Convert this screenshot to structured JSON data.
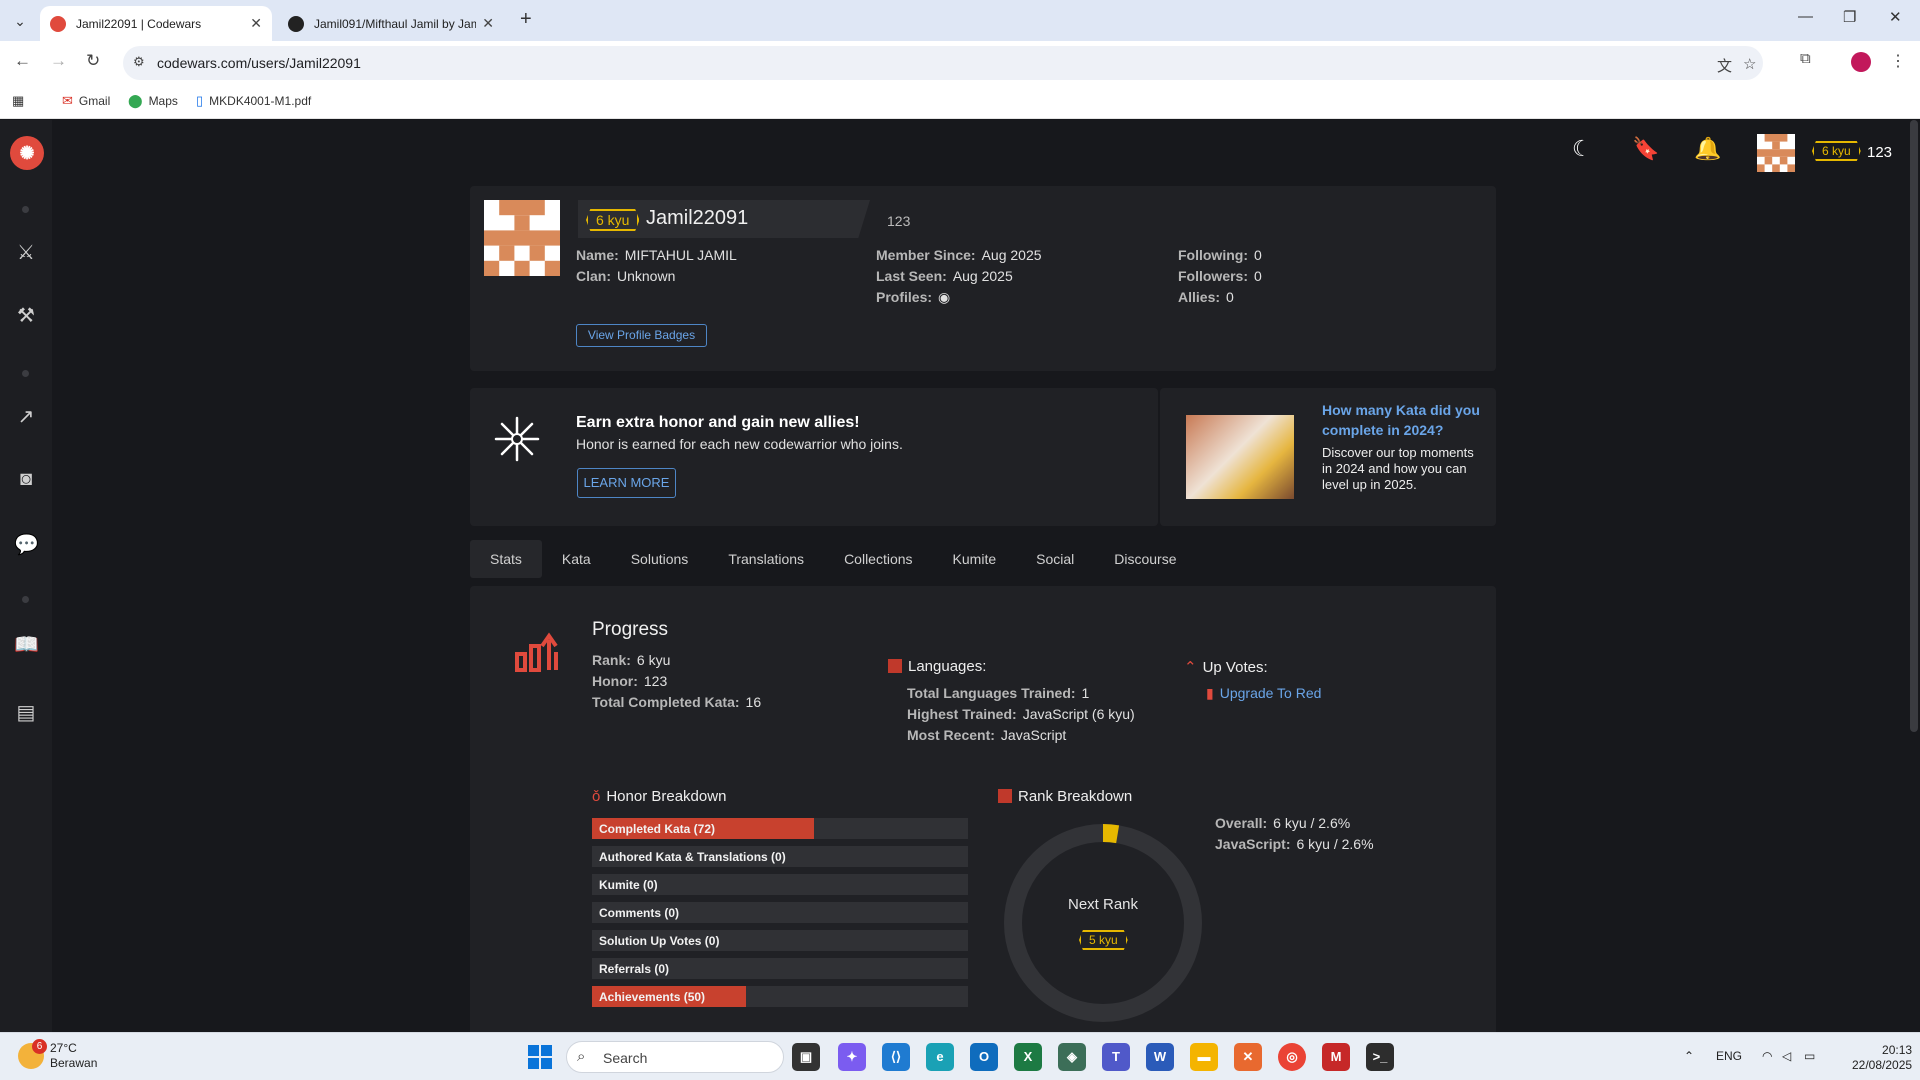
{
  "browser": {
    "tabs": [
      {
        "title": "Jamil22091 | Codewars",
        "active": true
      },
      {
        "title": "Jamil091/Mifthaul Jamil by Jam",
        "active": false
      }
    ],
    "url": "codewars.com/users/Jamil22091",
    "bookmarks": [
      "Gmail",
      "Maps",
      "MKDK4001-M1.pdf"
    ]
  },
  "topbar": {
    "kyu": "6 kyu",
    "honor": "123"
  },
  "profile": {
    "kyu": "6 kyu",
    "username": "Jamil22091",
    "honor": "123",
    "name_label": "Name:",
    "name": "MIFTAHUL JAMIL",
    "clan_label": "Clan:",
    "clan": "Unknown",
    "member_since_label": "Member Since:",
    "member_since": "Aug 2025",
    "last_seen_label": "Last Seen:",
    "last_seen": "Aug 2025",
    "profiles_label": "Profiles:",
    "following_label": "Following:",
    "following": "0",
    "followers_label": "Followers:",
    "followers": "0",
    "allies_label": "Allies:",
    "allies": "0",
    "badges_button": "View Profile Badges"
  },
  "banner": {
    "title": "Earn extra honor and gain new allies!",
    "subtitle": "Honor is earned for each new codewarrior who joins.",
    "button": "LEARN MORE"
  },
  "promo": {
    "title": "How many Kata did you complete in 2024?",
    "text": "Discover our top moments in 2024 and how you can level up in 2025."
  },
  "tabs": [
    "Stats",
    "Kata",
    "Solutions",
    "Translations",
    "Collections",
    "Kumite",
    "Social",
    "Discourse"
  ],
  "progress": {
    "title": "Progress",
    "rank_label": "Rank:",
    "rank": "6 kyu",
    "honor_label": "Honor:",
    "honor": "123",
    "completed_label": "Total Completed Kata:",
    "completed": "16"
  },
  "languages": {
    "title": "Languages:",
    "trained_label": "Total Languages Trained:",
    "trained": "1",
    "highest_label": "Highest Trained:",
    "highest": "JavaScript (6 kyu)",
    "recent_label": "Most Recent:",
    "recent": "JavaScript"
  },
  "upvotes": {
    "title": "Up Votes:",
    "link": "Upgrade To Red"
  },
  "honor_breakdown": {
    "title": "Honor Breakdown",
    "rows": [
      {
        "label": "Completed Kata (72)",
        "fill": 0.59
      },
      {
        "label": "Authored Kata & Translations (0)",
        "fill": 0
      },
      {
        "label": "Kumite (0)",
        "fill": 0
      },
      {
        "label": "Comments (0)",
        "fill": 0
      },
      {
        "label": "Solution Up Votes (0)",
        "fill": 0
      },
      {
        "label": "Referrals (0)",
        "fill": 0
      },
      {
        "label": "Achievements (50)",
        "fill": 0.41
      }
    ]
  },
  "rank_breakdown": {
    "title": "Rank Breakdown",
    "next_rank_label": "Next Rank",
    "next_rank": "5 kyu",
    "progress_percent": 2.6,
    "overall_label": "Overall:",
    "overall": "6 kyu / 2.6%",
    "js_label": "JavaScript:",
    "js": "6 kyu / 2.6%"
  },
  "taskbar": {
    "temp": "27°C",
    "weather": "Berawan",
    "weather_badge": "6",
    "search": "Search",
    "lang": "ENG",
    "time": "20:13",
    "date": "22/08/2025"
  },
  "colors": {
    "accent": "#e04a3d",
    "kyu": "#e6b800",
    "link": "#6aa5e8"
  }
}
